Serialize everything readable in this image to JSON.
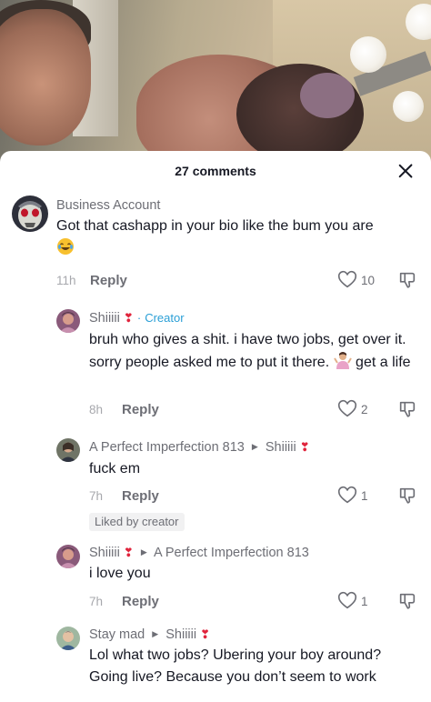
{
  "header": {
    "title": "27 comments"
  },
  "comments": [
    {
      "user": "Business Account",
      "text": "Got that cashapp in your bio like the bum you are",
      "emoji": "laughing-emoji",
      "time": "11h",
      "reply": "Reply",
      "likes": "10"
    },
    {
      "user": "Shiiiii",
      "badge": "Creator",
      "badge_sep": "·",
      "text": "bruh who gives a shit. i have two jobs, get over it. sorry people asked me to put it there.",
      "text_end": "get a life",
      "time": "8h",
      "reply": "Reply",
      "likes": "2"
    },
    {
      "user": "A Perfect Imperfection 813",
      "reply_to": "Shiiiii",
      "text": "fuck em",
      "time": "7h",
      "reply": "Reply",
      "likes": "1",
      "liked_by": "Liked by creator"
    },
    {
      "user": "Shiiiii",
      "reply_to": "A Perfect Imperfection 813",
      "text": "i love you",
      "time": "7h",
      "reply": "Reply",
      "likes": "1"
    },
    {
      "user": "Stay mad",
      "reply_to": "Shiiiii",
      "text": "Lol what two jobs? Ubering your boy around? Going live? Because you don’t seem to work"
    }
  ],
  "colors": {
    "heart": "#e0243c",
    "creator": "#2a9fd6",
    "muted": "#6d6e75"
  }
}
